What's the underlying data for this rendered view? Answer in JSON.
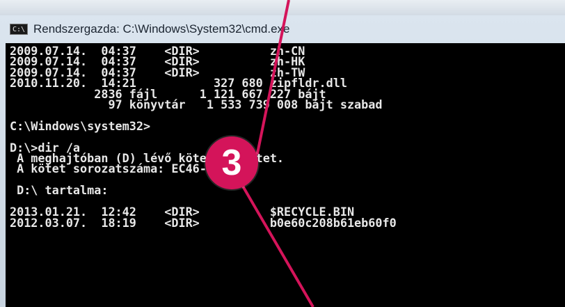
{
  "window": {
    "title": "Rendszergazda: C:\\Windows\\System32\\cmd.exe",
    "icon": "cmd-icon",
    "icon_text": "C:\\"
  },
  "console": {
    "lines": [
      "2009.07.14.  04:37    <DIR>          zh-CN",
      "2009.07.14.  04:37    <DIR>          zh-HK",
      "2009.07.14.  04:37    <DIR>          zh-TW",
      "2010.11.20.  14:21           327 680 zipfldr.dll",
      "            2836 fájl      1 121 667 227 bájt",
      "              97 könyvtár   1 533 739 008 bájt szabad",
      "",
      "C:\\Windows\\system32>",
      "",
      "D:\\>dir /a",
      " A meghajtóban (D) lévő kötet Új kötet.",
      " A kötet sorozatszáma: EC46-203F",
      "",
      " D:\\ tartalma:",
      "",
      "2013.01.21.  12:42    <DIR>          $RECYCLE.BIN",
      "2012.03.07.  18:19    <DIR>          b0e60c208b61eb60f0"
    ]
  },
  "annotation": {
    "number": "3",
    "color": "#d4145a"
  }
}
